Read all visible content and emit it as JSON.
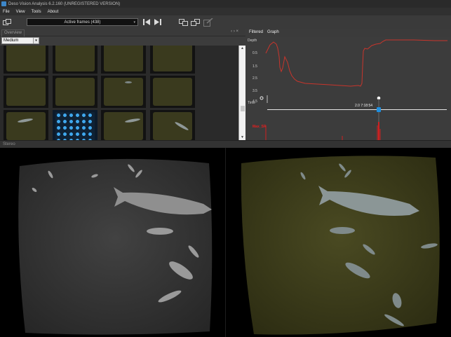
{
  "app": {
    "title": "Deso Vision Analysis 6.2.160 (UNREGISTERED VERSION)"
  },
  "menu": {
    "items": [
      "File",
      "View",
      "Tools",
      "About"
    ]
  },
  "toolbar": {
    "frames_filter_value": "Active frames (438)",
    "icons": [
      "open-stereo-icon",
      "first-frame-icon",
      "last-frame-icon",
      "copy-left-icon",
      "copy-right-icon",
      "edit-icon"
    ]
  },
  "overview": {
    "tab_label": "Overview",
    "size_value": "Medium",
    "thumbnail_rows": 4,
    "thumbnail_cols": 4
  },
  "graph_panel": {
    "tabs": [
      "Filtered",
      "Graph"
    ],
    "y_axis_title": "Depth",
    "y_labels": [
      "0.5",
      "1.5",
      "2.5",
      "3.5",
      "4.5"
    ],
    "x_label": "Time",
    "time_readout": "2.0  7:18:54",
    "red_label": "Max_SR",
    "line_color": "#cc2a22",
    "timeline_color": "#1e8fe0"
  },
  "stereo": {
    "label": "Stereo",
    "left_tint": "#3a3a3a",
    "right_tint": "#3a3a1c"
  }
}
